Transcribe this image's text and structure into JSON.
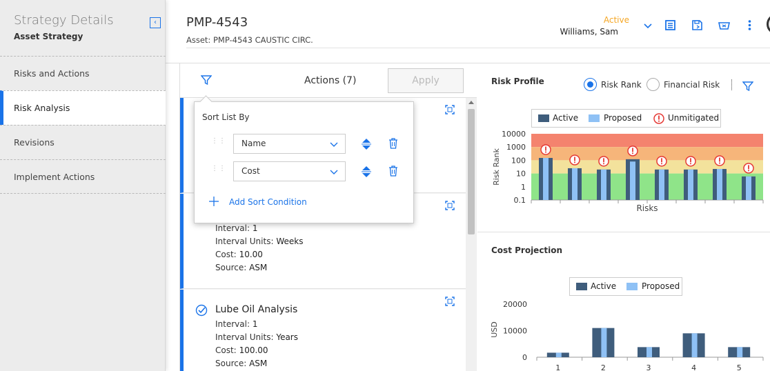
{
  "sidebar": {
    "title": "Strategy Details",
    "subtitle": "Asset Strategy",
    "collapse_icon": "chevron-left-icon",
    "items": [
      {
        "label": "Risks and Actions",
        "active": false
      },
      {
        "label": "Risk Analysis",
        "active": true
      },
      {
        "label": "Revisions",
        "active": false
      },
      {
        "label": "Implement Actions",
        "active": false
      }
    ]
  },
  "header": {
    "title": "PMP-4543",
    "asset": "Asset: PMP-4543 CAUSTIC CIRC.",
    "status": "Active",
    "user": "Williams, Sam",
    "icons": [
      "chevron-down-icon",
      "list-icon",
      "save-icon",
      "basket-icon",
      "more-vertical-icon"
    ]
  },
  "actions_panel": {
    "title": "Actions (7)",
    "apply_label": "Apply",
    "cards": [
      {
        "title": "",
        "lines": []
      },
      {
        "title": "",
        "lines": [
          {
            "label": "Interval:",
            "value": "1"
          },
          {
            "label": "Interval Units:",
            "value": "Weeks"
          },
          {
            "label": "Cost:",
            "value": "10.00"
          },
          {
            "label": "Source:",
            "value": "ASM"
          }
        ]
      },
      {
        "title": "Lube Oil Analysis",
        "lines": [
          {
            "label": "Interval:",
            "value": "1"
          },
          {
            "label": "Interval Units:",
            "value": "Years"
          },
          {
            "label": "Cost:",
            "value": "100.00"
          },
          {
            "label": "Source:",
            "value": "ASM"
          }
        ]
      }
    ]
  },
  "sort_popover": {
    "title": "Sort List By",
    "conditions": [
      {
        "field": "Name"
      },
      {
        "field": "Cost"
      }
    ],
    "add_label": "Add Sort Condition"
  },
  "risk_profile": {
    "title": "Risk Profile",
    "radio_risk_rank": "Risk Rank",
    "radio_financial": "Financial Risk",
    "selected": "Risk Rank",
    "legend": {
      "active": "Active",
      "proposed": "Proposed",
      "unmitigated": "Unmitigated"
    }
  },
  "cost_projection": {
    "title": "Cost Projection",
    "legend": {
      "active": "Active",
      "proposed": "Proposed"
    }
  },
  "colors": {
    "accent": "#1a73e8",
    "active_bar": "#3f5d7c",
    "proposed_bar": "#8fc1f5",
    "status_active": "#f5a623",
    "zone_red": "#f4836e",
    "zone_orange": "#f6b57a",
    "zone_yellow": "#f3e29c",
    "zone_green": "#8fe489",
    "unmitigated": "#e53935"
  },
  "chart_data": [
    {
      "type": "bar",
      "title": "Risk Profile",
      "xlabel": "Risks",
      "ylabel": "Risk Rank",
      "yscale": "log",
      "ylim": [
        0.1,
        10000
      ],
      "yticks": [
        "0.1",
        "1",
        "10",
        "100",
        "1000",
        "10000"
      ],
      "legend_position": "top",
      "series": [
        {
          "name": "Active",
          "values": [
            150,
            25,
            20,
            120,
            20,
            20,
            22,
            6
          ]
        },
        {
          "name": "Proposed",
          "values": [
            150,
            25,
            20,
            80,
            20,
            20,
            22,
            6
          ]
        }
      ],
      "unmitigated_flags": [
        true,
        true,
        true,
        true,
        true,
        true,
        true,
        true
      ]
    },
    {
      "type": "bar",
      "title": "Cost Projection",
      "categories": [
        "1",
        "2",
        "3",
        "4",
        "5"
      ],
      "ylabel": "USD",
      "ylim": [
        0,
        20000
      ],
      "yticks": [
        "0",
        "10000",
        "20000"
      ],
      "legend_position": "top",
      "series": [
        {
          "name": "Active",
          "values": [
            1700,
            11000,
            3800,
            9000,
            3800
          ]
        },
        {
          "name": "Proposed",
          "values": [
            1700,
            11000,
            3800,
            9000,
            3800
          ]
        }
      ]
    }
  ]
}
